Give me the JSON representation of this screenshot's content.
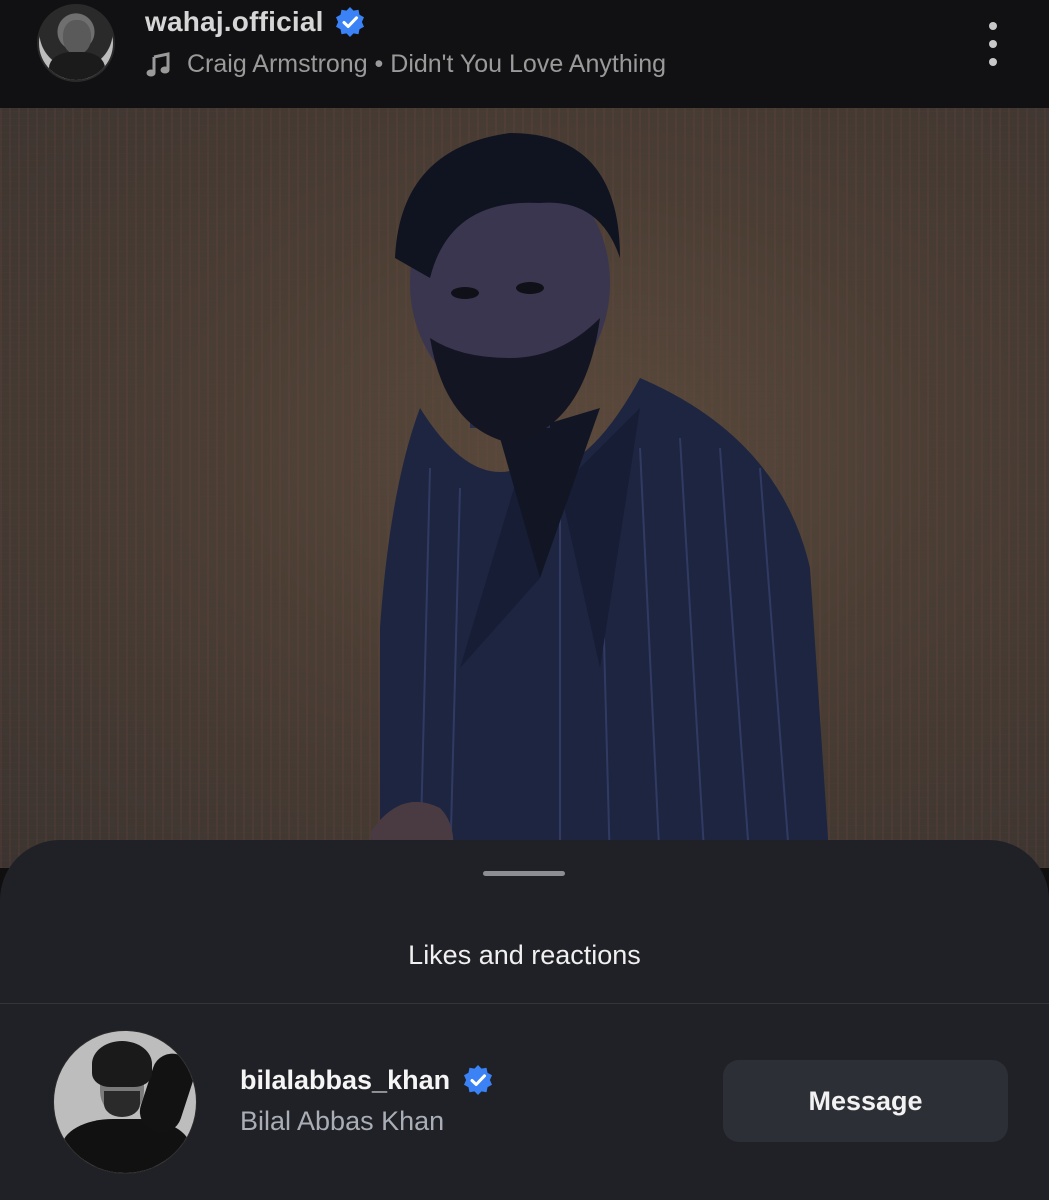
{
  "post_header": {
    "username": "wahaj.official",
    "music": "Craig Armstrong • Didn't You Love Anything"
  },
  "icons": {
    "verified": "verified-badge-icon",
    "music": "music-note-icon",
    "more": "more-options-icon"
  },
  "colors": {
    "verified_blue": "#3b82f6",
    "sheet_background": "#202126",
    "button_background": "#2c2f36"
  },
  "sheet": {
    "title": "Likes and reactions",
    "items": [
      {
        "username": "bilalabbas_khan",
        "full_name": "Bilal Abbas Khan",
        "button_label": "Message"
      }
    ]
  }
}
